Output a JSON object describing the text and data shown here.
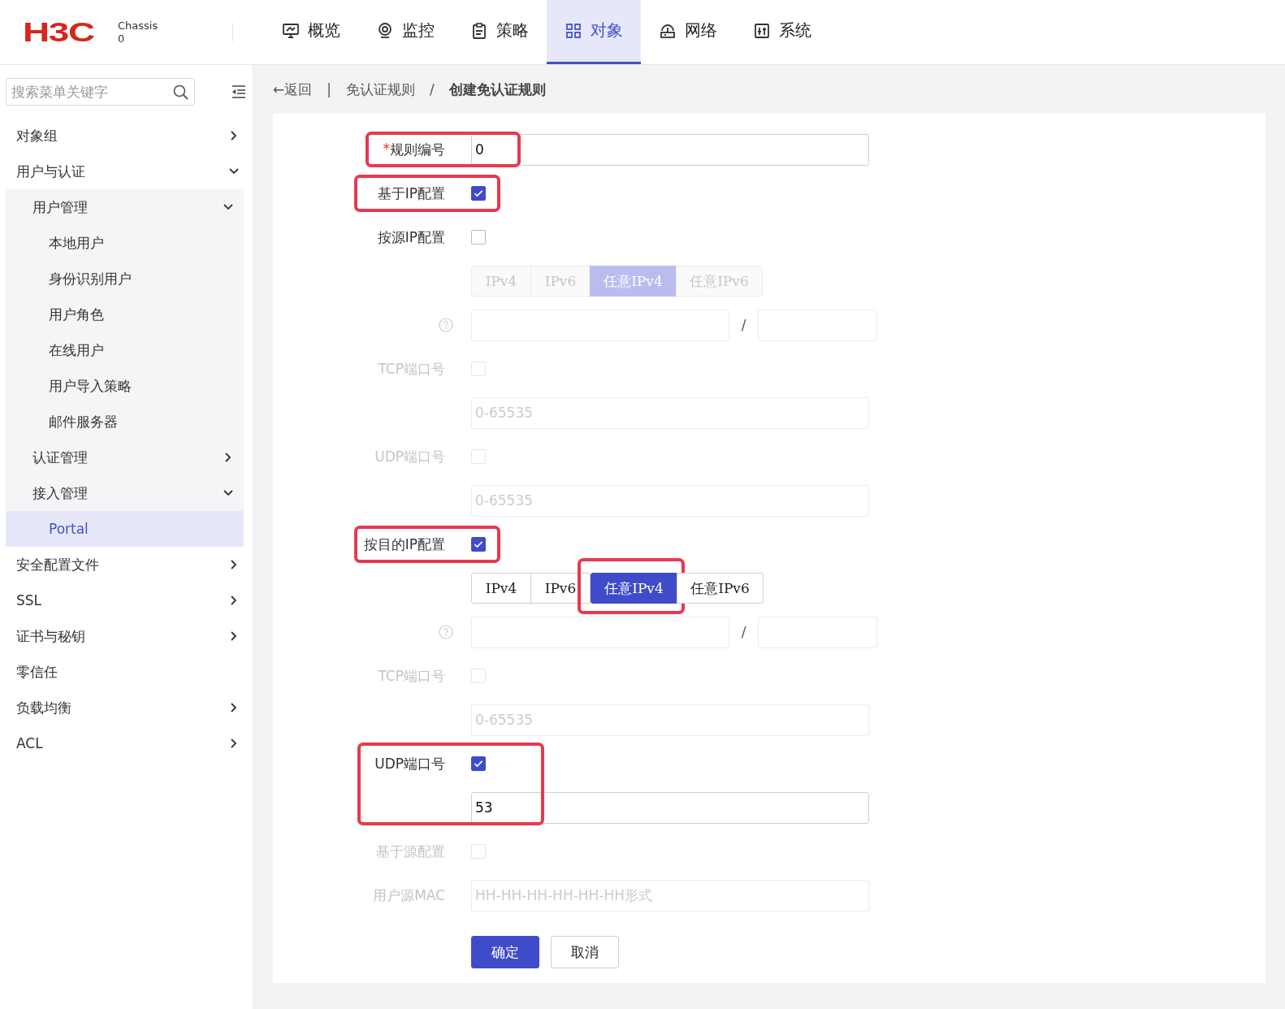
{
  "header": {
    "logo": "H3C",
    "device_name": "Chassis",
    "device_number": "0",
    "nav": [
      {
        "label": "概览",
        "selected": false
      },
      {
        "label": "监控",
        "selected": false
      },
      {
        "label": "策略",
        "selected": false
      },
      {
        "label": "对象",
        "selected": true
      },
      {
        "label": "网络",
        "selected": false
      },
      {
        "label": "系统",
        "selected": false
      }
    ]
  },
  "sidebar": {
    "search": {
      "placeholder": "搜索菜单关键字"
    },
    "items": [
      {
        "label": "对象组",
        "expanded": false,
        "selected": false
      },
      {
        "label": "用户与认证",
        "expanded": true,
        "selected": false,
        "children": [
          {
            "label": "用户管理",
            "expanded": true,
            "selected": false,
            "children": [
              {
                "label": "本地用户",
                "selected": false
              },
              {
                "label": "身份识别用户",
                "selected": false
              },
              {
                "label": "用户角色",
                "selected": false
              },
              {
                "label": "在线用户",
                "selected": false
              },
              {
                "label": "用户导入策略",
                "selected": false
              },
              {
                "label": "邮件服务器",
                "selected": false
              }
            ]
          },
          {
            "label": "认证管理",
            "expanded": false,
            "selected": false
          },
          {
            "label": "接入管理",
            "expanded": true,
            "selected": false,
            "children": [
              {
                "label": "Portal",
                "selected": true
              }
            ]
          }
        ]
      },
      {
        "label": "安全配置文件",
        "expanded": false,
        "selected": false
      },
      {
        "label": "SSL",
        "expanded": false,
        "selected": false
      },
      {
        "label": "证书与秘钥",
        "expanded": false,
        "selected": false
      },
      {
        "label": "零信任",
        "selected": false
      },
      {
        "label": "负载均衡",
        "expanded": false,
        "selected": false
      },
      {
        "label": "ACL",
        "expanded": false,
        "selected": false
      }
    ]
  },
  "breadcrumb": {
    "back": "←返回",
    "separator": "|",
    "items": [
      {
        "label": "免认证规则",
        "current": false
      },
      {
        "label": "创建免认证规则",
        "current": true
      }
    ],
    "divider": "/"
  },
  "form": {
    "rows": [
      {
        "kind": "input",
        "label": "规则编号",
        "required_mark": "*",
        "value": "0",
        "disabled": false,
        "highlighted": true
      },
      {
        "kind": "checkbox",
        "label": "基于IP配置",
        "checked": true,
        "disabled": false,
        "highlighted": true
      },
      {
        "kind": "checkbox",
        "label": "按源IP配置",
        "checked": false,
        "disabled": false,
        "highlighted": false
      },
      {
        "kind": "segmented",
        "disabled": true,
        "options": [
          {
            "label": "IPv4",
            "selected": false,
            "highlighted": false
          },
          {
            "label": "IPv6",
            "selected": false,
            "highlighted": false
          },
          {
            "label": "任意IPv4",
            "selected": true,
            "highlighted": false
          },
          {
            "label": "任意IPv6",
            "selected": false,
            "highlighted": false
          }
        ]
      },
      {
        "kind": "ip-mask",
        "disabled": true,
        "separator": "/"
      },
      {
        "kind": "checkbox",
        "label": "TCP端口号",
        "checked": false,
        "disabled": true,
        "highlighted": false,
        "field": {
          "placeholder": "0-65535",
          "disabled": true
        }
      },
      {
        "kind": "checkbox",
        "label": "UDP端口号",
        "checked": false,
        "disabled": true,
        "highlighted": false,
        "field": {
          "placeholder": "0-65535",
          "disabled": true
        }
      },
      {
        "kind": "checkbox",
        "label": "按目的IP配置",
        "checked": true,
        "disabled": false,
        "highlighted": true
      },
      {
        "kind": "segmented",
        "disabled": false,
        "options": [
          {
            "label": "IPv4",
            "selected": false,
            "highlighted": false
          },
          {
            "label": "IPv6",
            "selected": false,
            "highlighted": false
          },
          {
            "label": "任意IPv4",
            "selected": true,
            "highlighted": true
          },
          {
            "label": "任意IPv6",
            "selected": false,
            "highlighted": false
          }
        ]
      },
      {
        "kind": "ip-mask",
        "disabled": true,
        "separator": "/"
      },
      {
        "kind": "checkbox",
        "label": "TCP端口号",
        "checked": false,
        "disabled": true,
        "highlighted": false,
        "field": {
          "placeholder": "0-65535",
          "disabled": true
        }
      },
      {
        "kind": "checkbox",
        "label": "UDP端口号",
        "checked": true,
        "disabled": false,
        "highlighted": true,
        "field": {
          "value": "53",
          "disabled": false
        }
      },
      {
        "kind": "checkbox",
        "label": "基于源配置",
        "checked": false,
        "disabled": true,
        "highlighted": false
      },
      {
        "kind": "input",
        "label": "用户源MAC",
        "placeholder": "HH-HH-HH-HH-HH-HH形式",
        "disabled": true,
        "highlighted": false
      }
    ],
    "buttons": [
      {
        "label": "确定",
        "primary": true
      },
      {
        "label": "取消",
        "primary": false
      }
    ]
  }
}
